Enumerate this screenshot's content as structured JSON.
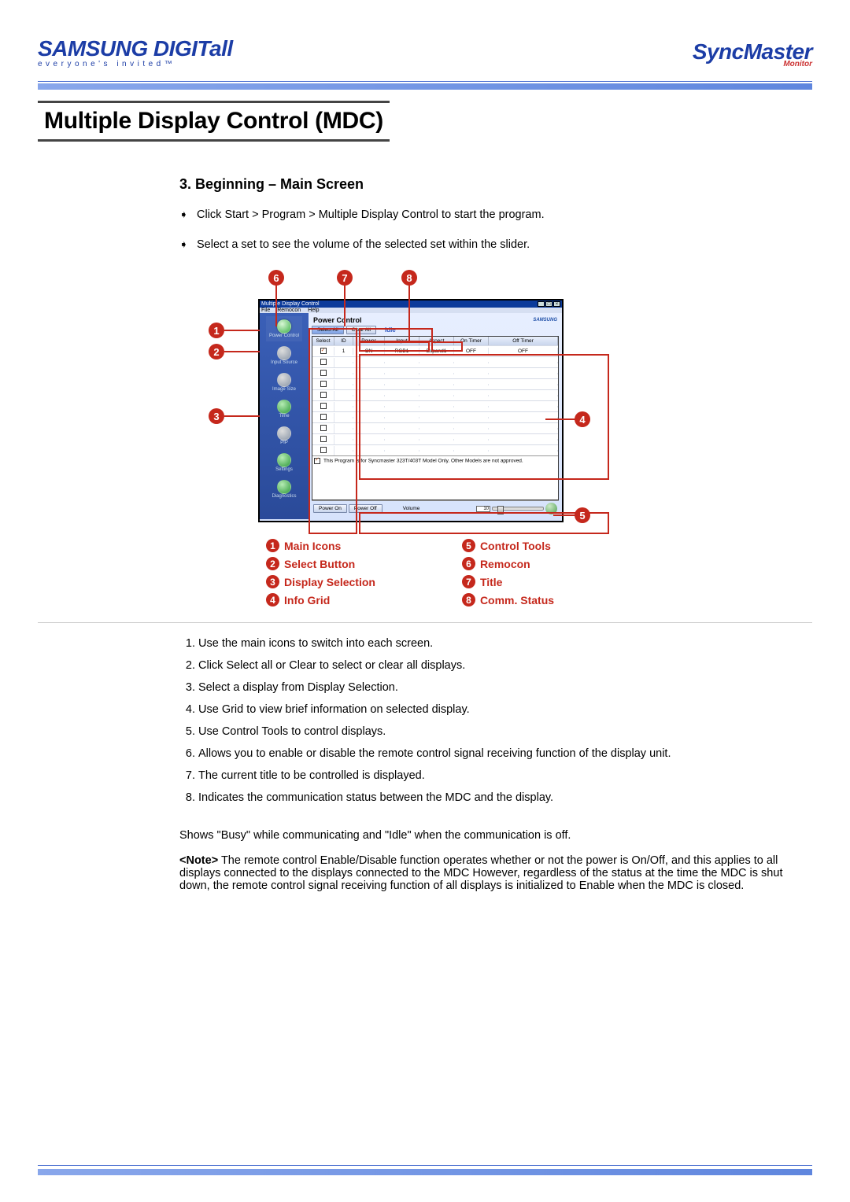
{
  "header": {
    "brand_left_name": "SAMSUNG DIGITall",
    "brand_left_tag": "everyone's invited™",
    "brand_right_name": "SyncMaster",
    "brand_right_sub": "Monitor"
  },
  "title": "Multiple Display Control (MDC)",
  "section_heading": "3. Beginning – Main Screen",
  "bullets": [
    "Click Start > Program > Multiple Display Control to start the program.",
    "Select a set to see the volume of the selected set within the slider."
  ],
  "app": {
    "window_title": "Multiple Display Control",
    "menus": [
      "File",
      "Remocon",
      "Help"
    ],
    "sidebar_items": [
      "Power Control",
      "Input Source",
      "Image Size",
      "Time",
      "PIP",
      "Settings",
      "Diagnostics"
    ],
    "panel_title": "Power Control",
    "select_all_btn": "Select All",
    "clear_all_btn": "Clear All",
    "comm_status": "Idle",
    "grid_headers": [
      "Select",
      "ID",
      "Power",
      "Input",
      "Aspect",
      "On Timer",
      "Off Timer"
    ],
    "grid_row1": {
      "id": "1",
      "power": "ON",
      "input": "RGB1",
      "aspect": "Expand1",
      "on_timer": "OFF",
      "off_timer": "OFF"
    },
    "footer_notice": "This Program is for Syncmaster 323T/403T Model Only. Other Models are not approved.",
    "power_on_btn": "Power On",
    "power_off_btn": "Power Off",
    "volume_label": "Volume",
    "volume_value": "10",
    "samsung_small": "SAMSUNG"
  },
  "callouts": {
    "1": "1",
    "2": "2",
    "3": "3",
    "4": "4",
    "5": "5",
    "6": "6",
    "7": "7",
    "8": "8"
  },
  "legend": [
    {
      "n": "1",
      "label": "Main Icons"
    },
    {
      "n": "2",
      "label": "Select Button"
    },
    {
      "n": "3",
      "label": "Display Selection"
    },
    {
      "n": "4",
      "label": "Info Grid"
    },
    {
      "n": "5",
      "label": "Control Tools"
    },
    {
      "n": "6",
      "label": "Remocon"
    },
    {
      "n": "7",
      "label": "Title"
    },
    {
      "n": "8",
      "label": "Comm. Status"
    }
  ],
  "numbered_steps": [
    "Use the main icons to switch into each screen.",
    "Click Select all or Clear to select or clear all displays.",
    "Select a display from Display Selection.",
    "Use Grid to view brief information on selected display.",
    "Use Control Tools to control displays.",
    "Allows you to enable or disable the remote control signal receiving function of the display unit.",
    "The current title to be controlled is displayed.",
    "Indicates the communication status between the MDC and the display."
  ],
  "idle_line": "Shows \"Busy\" while communicating and \"Idle\" when the communication is off.",
  "note_label": "<Note>",
  "note_body": "The remote control Enable/Disable function operates whether or not the power is On/Off, and this applies to all displays connected to the displays connected to the MDC However, regardless of the status at the time the MDC is shut down, the remote control signal receiving function of all displays is initialized to Enable when the MDC is closed."
}
